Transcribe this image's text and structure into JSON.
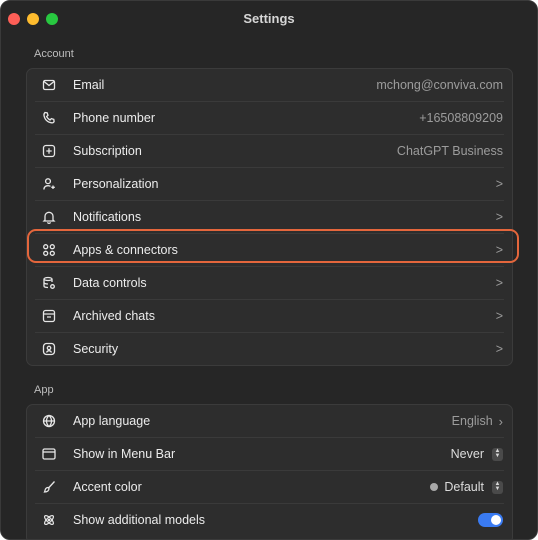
{
  "window": {
    "title": "Settings",
    "traffic_lights": {
      "close": "#fe5f57",
      "minimize": "#febc2e",
      "zoom": "#28c840"
    }
  },
  "account": {
    "section_label": "Account",
    "rows": [
      {
        "label": "Email",
        "value": "mchong@conviva.com",
        "icon": "mail-icon"
      },
      {
        "label": "Phone number",
        "value": "+16508809209",
        "icon": "phone-icon"
      },
      {
        "label": "Subscription",
        "value": "ChatGPT Business",
        "icon": "plus-square-icon"
      },
      {
        "label": "Personalization",
        "value": ">",
        "icon": "person-sparkle-icon"
      },
      {
        "label": "Notifications",
        "value": ">",
        "icon": "bell-icon"
      },
      {
        "label": "Apps & connectors",
        "value": ">",
        "icon": "grid-icon"
      },
      {
        "label": "Data controls",
        "value": ">",
        "icon": "database-gear-icon"
      },
      {
        "label": "Archived chats",
        "value": ">",
        "icon": "archive-icon"
      },
      {
        "label": "Security",
        "value": ">",
        "icon": "shield-icon"
      }
    ]
  },
  "app": {
    "section_label": "App",
    "rows": [
      {
        "label": "App language",
        "value": "English",
        "icon": "globe-icon"
      },
      {
        "label": "Show in Menu Bar",
        "value": "Never",
        "icon": "window-icon"
      },
      {
        "label": "Accent color",
        "value": "Default",
        "icon": "brush-icon"
      },
      {
        "label": "Show additional models",
        "icon": "atom-icon",
        "toggle_on": true
      }
    ]
  },
  "colors": {
    "highlight": "#e4663c",
    "toggle_accent": "#3a7bf2"
  }
}
